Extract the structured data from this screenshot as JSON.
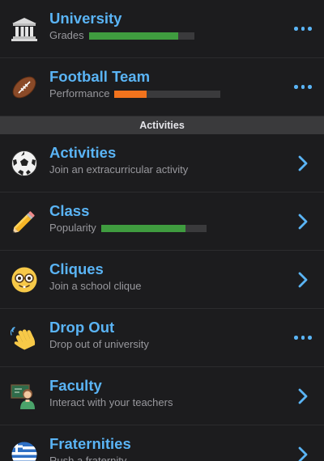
{
  "accent_color": "#5ab4f5",
  "top_rows": [
    {
      "title": "University",
      "subtitle": "Grades",
      "bar_fill": 0.85,
      "bar_color": "#3f9c3f",
      "icon": "university-building-icon",
      "action": "more-options"
    },
    {
      "title": "Football Team",
      "subtitle": "Performance",
      "bar_fill": 0.3,
      "bar_color": "#f2731d",
      "icon": "football-icon",
      "action": "more-options"
    }
  ],
  "section_header": "Activities",
  "rows": [
    {
      "title": "Activities",
      "subtitle": "Join an extracurricular activity",
      "icon": "soccer-ball-icon",
      "action": "chevron-right"
    },
    {
      "title": "Class",
      "subtitle": "Popularity",
      "bar_fill": 0.8,
      "bar_color": "#3f9c3f",
      "icon": "pencil-icon",
      "action": "chevron-right"
    },
    {
      "title": "Cliques",
      "subtitle": "Join a school clique",
      "icon": "nerd-face-icon",
      "action": "chevron-right"
    },
    {
      "title": "Drop Out",
      "subtitle": "Drop out of university",
      "icon": "waving-hand-icon",
      "action": "more-options"
    },
    {
      "title": "Faculty",
      "subtitle": "Interact with your teachers",
      "icon": "teacher-icon",
      "action": "chevron-right"
    },
    {
      "title": "Fraternities",
      "subtitle": "Rush a fraternity",
      "icon": "greek-flag-icon",
      "action": "chevron-right"
    }
  ]
}
